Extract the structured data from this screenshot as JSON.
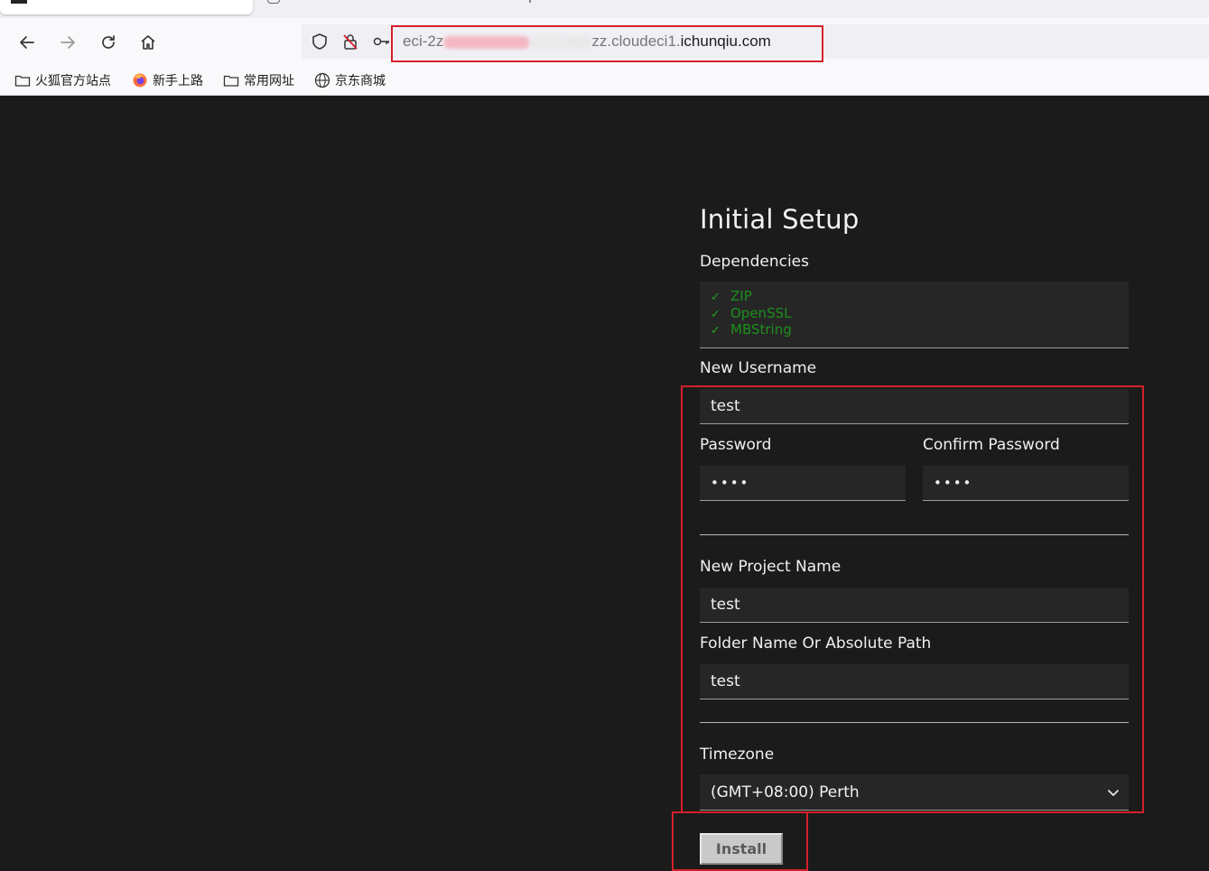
{
  "browser": {
    "url": {
      "prefix": "eci-2z",
      "visible_mid": "zz.cloudeci1.",
      "host": "ichunqiu.com"
    },
    "bookmarks": [
      {
        "label": "火狐官方站点",
        "icon": "folder-icon"
      },
      {
        "label": "新手上路",
        "icon": "firefox-icon"
      },
      {
        "label": "常用网址",
        "icon": "folder-icon"
      },
      {
        "label": "京东商城",
        "icon": "globe-icon"
      }
    ]
  },
  "setup": {
    "title": "Initial Setup",
    "dependencies_label": "Dependencies",
    "dependencies": [
      "ZIP",
      "OpenSSL",
      "MBString"
    ],
    "check_mark": "✓",
    "username_label": "New Username",
    "username_value": "test",
    "password_label": "Password",
    "password_value": "••••",
    "confirm_password_label": "Confirm Password",
    "confirm_password_value": "••••",
    "project_name_label": "New Project Name",
    "project_name_value": "test",
    "folder_label": "Folder Name Or Absolute Path",
    "folder_value": "test",
    "timezone_label": "Timezone",
    "timezone_value": "(GMT+08:00) Perth",
    "install_label": "Install"
  },
  "colors": {
    "page_bg": "#1b1b1b",
    "field_bg": "#262626",
    "dependency_ok": "#1c8f1c",
    "annotation_red": "#d4202a"
  }
}
